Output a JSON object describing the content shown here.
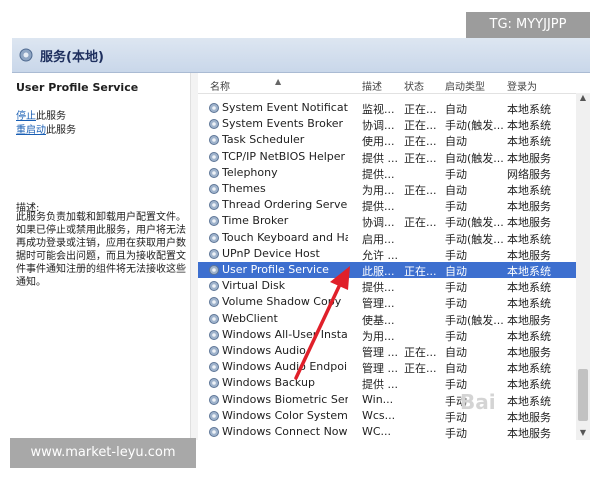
{
  "badges": {
    "telegram": "TG: MYYJJPP",
    "website": "www.market-leyu.com"
  },
  "watermark": "Bai",
  "window": {
    "title": "服务(本地)"
  },
  "left_pane": {
    "service_title": "User Profile Service",
    "stop_link_prefix": "停止",
    "stop_link_suffix": "此服务",
    "restart_link_prefix": "重启动",
    "restart_link_suffix": "此服务",
    "desc_label": "描述:",
    "description": "此服务负责加载和卸载用户配置文件。如果已停止或禁用此服务，用户将无法再成功登录或注销，应用在获取用户数据时可能会出问题，而且为接收配置文件事件通知注册的组件将无法接收这些通知。"
  },
  "columns": {
    "name": "名称",
    "desc": "描述",
    "status": "状态",
    "start": "启动类型",
    "logon": "登录为"
  },
  "rows": [
    {
      "name": "System Event Notification...",
      "desc": "监视...",
      "status": "正在...",
      "start": "自动",
      "logon": "本地系统"
    },
    {
      "name": "System Events Broker",
      "desc": "协调...",
      "status": "正在...",
      "start": "手动(触发...",
      "logon": "本地系统"
    },
    {
      "name": "Task Scheduler",
      "desc": "使用...",
      "status": "正在...",
      "start": "自动",
      "logon": "本地系统"
    },
    {
      "name": "TCP/IP NetBIOS Helper",
      "desc": "提供 ...",
      "status": "正在...",
      "start": "自动(触发...",
      "logon": "本地服务"
    },
    {
      "name": "Telephony",
      "desc": "提供...",
      "status": "",
      "start": "手动",
      "logon": "网络服务"
    },
    {
      "name": "Themes",
      "desc": "为用...",
      "status": "正在...",
      "start": "自动",
      "logon": "本地系统"
    },
    {
      "name": "Thread Ordering Server",
      "desc": "提供...",
      "status": "",
      "start": "手动",
      "logon": "本地服务"
    },
    {
      "name": "Time Broker",
      "desc": "协调...",
      "status": "正在...",
      "start": "手动(触发...",
      "logon": "本地服务"
    },
    {
      "name": "Touch Keyboard and Ha...",
      "desc": "启用...",
      "status": "",
      "start": "手动(触发...",
      "logon": "本地系统"
    },
    {
      "name": "UPnP Device Host",
      "desc": "允许 ...",
      "status": "",
      "start": "手动",
      "logon": "本地服务"
    },
    {
      "name": "User Profile Service",
      "desc": "此服...",
      "status": "正在...",
      "start": "自动",
      "logon": "本地系统"
    },
    {
      "name": "Virtual Disk",
      "desc": "提供...",
      "status": "",
      "start": "手动",
      "logon": "本地系统"
    },
    {
      "name": "Volume Shadow Copy",
      "desc": "管理...",
      "status": "",
      "start": "手动",
      "logon": "本地系统"
    },
    {
      "name": "WebClient",
      "desc": "使基...",
      "status": "",
      "start": "手动(触发...",
      "logon": "本地服务"
    },
    {
      "name": "Windows All-User Install ...",
      "desc": "为用...",
      "status": "",
      "start": "手动",
      "logon": "本地系统"
    },
    {
      "name": "Windows Audio",
      "desc": "管理 ...",
      "status": "正在...",
      "start": "自动",
      "logon": "本地服务"
    },
    {
      "name": "Windows Audio Endpoint...",
      "desc": "管理 ...",
      "status": "正在...",
      "start": "自动",
      "logon": "本地系统"
    },
    {
      "name": "Windows Backup",
      "desc": "提供 ...",
      "status": "",
      "start": "手动",
      "logon": "本地系统"
    },
    {
      "name": "Windows Biometric Servi...",
      "desc": "Win...",
      "status": "",
      "start": "手动",
      "logon": "本地系统"
    },
    {
      "name": "Windows Color System",
      "desc": "Wcs...",
      "status": "",
      "start": "手动",
      "logon": "本地服务"
    },
    {
      "name": "Windows Connect Now -...",
      "desc": "WC...",
      "status": "",
      "start": "手动",
      "logon": "本地服务"
    }
  ],
  "selected_row_index": 10,
  "colors": {
    "selection": "#3d6fcf",
    "link": "#1a5fb4",
    "annotation_arrow": "#e0202a"
  }
}
